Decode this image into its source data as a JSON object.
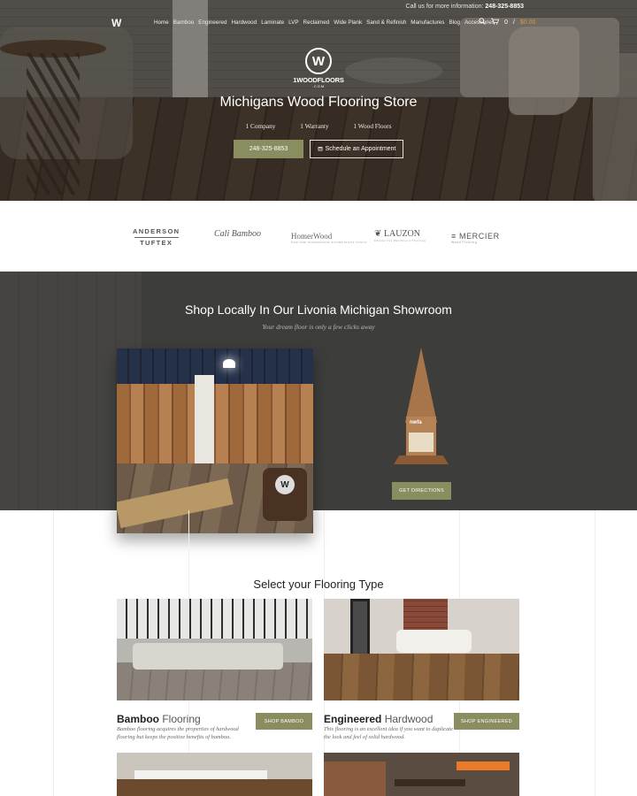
{
  "topbar": {
    "text": "Call us for more information:",
    "phone": "248-325-8853"
  },
  "logo": {
    "mark": "W"
  },
  "nav": {
    "items": [
      "Home",
      "Bamboo",
      "Engineered",
      "Hardwood",
      "Laminate",
      "LVP",
      "Reclaimed",
      "Wide Plank",
      "Sand & Refinish",
      "Manufactures",
      "Blog",
      "Accessories"
    ]
  },
  "cart": {
    "count": "0",
    "total": "$0.00",
    "separator": "/"
  },
  "brand": {
    "mark": "W",
    "name": "1WOODFLOORS",
    "domain": ".COM"
  },
  "hero": {
    "title": "Michigans Wood Flooring Store",
    "taglines": [
      "1 Company",
      "1 Warranty",
      "1 Wood Floors"
    ],
    "phone_button": "248-325-8853",
    "appointment_button": "Schedule an Appointment"
  },
  "brands": {
    "anderson": "ANDERSON",
    "tuftex": "TUFTEX",
    "cali": "Cali Bamboo",
    "homerwood": "HomerWood",
    "homerwood_tag": "FOR THE HARDWOOD ENTHUSIAST SINCE",
    "lauzon": "LAUZON",
    "lauzon_tag": "Distinctive Hardwood Flooring",
    "mercier": "MERCIER",
    "mercier_tag": "Wood Flooring"
  },
  "showroom": {
    "title": "Shop Locally In Our Livonia Michigan Showroom",
    "subtitle": "Your dream floor is only a few clicks away",
    "directions_button": "GET DIRECTIONS",
    "award_text": "nwfa"
  },
  "flooring": {
    "title": "Select your Flooring Type",
    "cards": [
      {
        "bold": "Bamboo",
        "thin": " Flooring",
        "desc": "Bamboo flooring acquires the properties of hardwood flooring but keeps the positive benefits of bamboo.",
        "button": "SHOP BAMBOO"
      },
      {
        "bold": "Engineered",
        "thin": " Hardwood",
        "desc": "This flooring is an excellent idea if you want to duplicate the look and feel of solid hardwood.",
        "button": "SHOP ENGINEERED"
      }
    ]
  }
}
